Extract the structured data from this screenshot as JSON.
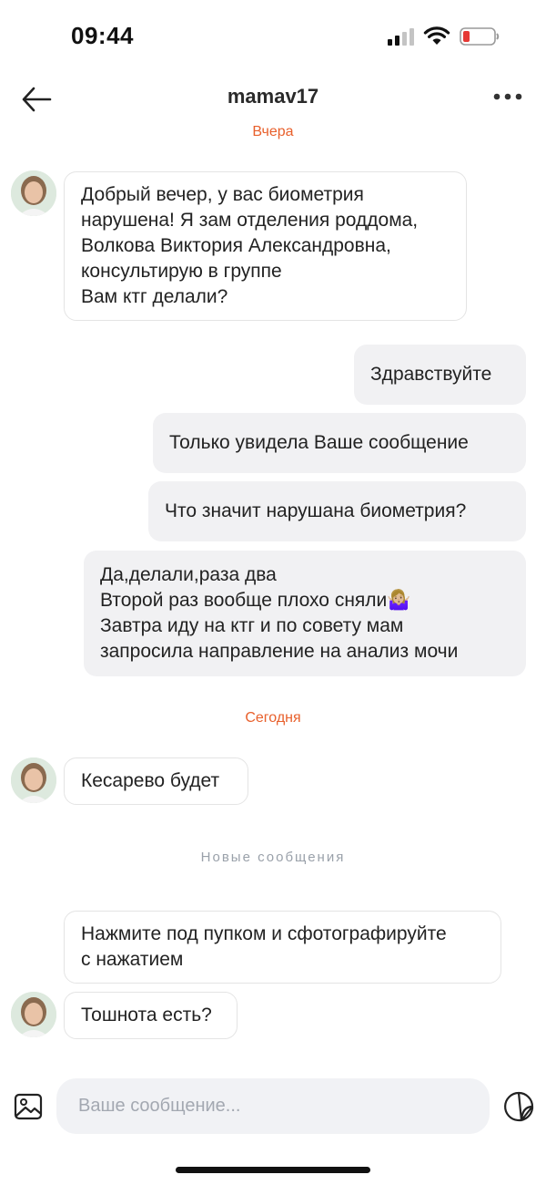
{
  "status_bar": {
    "time": "09:44"
  },
  "header": {
    "title": "mamav17",
    "back_icon": "arrow-left-icon",
    "more_icon": "more-horizontal-icon"
  },
  "separators": {
    "yesterday": "Вчера",
    "today": "Сегодня",
    "new_messages": "Новые сообщения"
  },
  "messages": [
    {
      "direction": "incoming",
      "text": "Добрый вечер, у вас биометрия\nнарушена! Я зам отделения роддома,\nВолкова Виктория Александровна,\nконсультирую в группе\nВам ктг делали?"
    },
    {
      "direction": "outgoing",
      "text": "Здравствуйте"
    },
    {
      "direction": "outgoing",
      "text": "Только увидела Ваше сообщение"
    },
    {
      "direction": "outgoing",
      "text": "Что значит нарушана биометрия?"
    },
    {
      "direction": "outgoing",
      "text": "Да,делали,раза два\nВторой раз вообще плохо сняли🤷🏼‍♀️\nЗавтра иду на ктг и по совету мам\nзапросила направление на анализ мочи"
    },
    {
      "direction": "incoming",
      "text": "Кесарево будет"
    },
    {
      "direction": "incoming",
      "text": "Нажмите под пупком и сфотографируйте\nс нажатием"
    },
    {
      "direction": "incoming",
      "text": "Тошнота есть?"
    }
  ],
  "composer": {
    "placeholder": "Ваше сообщение...",
    "image_icon": "image-icon",
    "sticker_icon": "sticker-icon"
  },
  "colors": {
    "separator_accent": "#e8602c",
    "outgoing_bubble": "#f1f1f3",
    "incoming_border": "#e4e4e4",
    "battery_low": "#e53935"
  }
}
